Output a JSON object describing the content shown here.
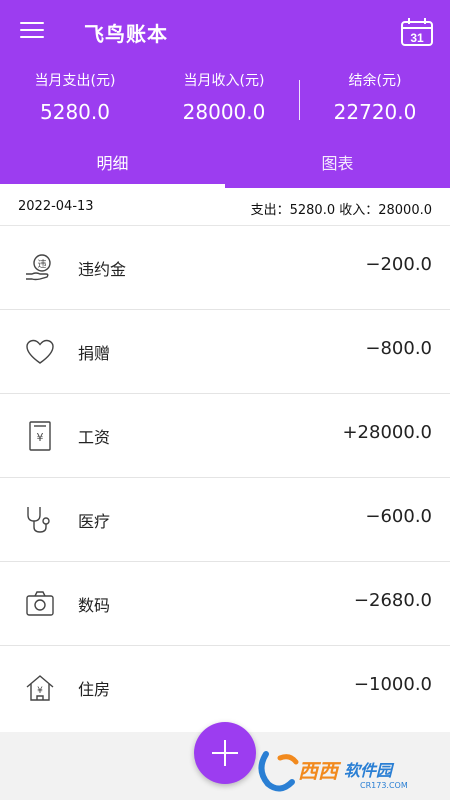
{
  "header": {
    "title": "飞鸟账本",
    "calendar_day": "31"
  },
  "summary": {
    "expense_label": "当月支出(元)",
    "expense_value": "5280.0",
    "income_label": "当月收入(元)",
    "income_value": "28000.0",
    "balance_label": "结余(元)",
    "balance_value": "22720.0"
  },
  "tabs": [
    {
      "label": "明细",
      "active": true
    },
    {
      "label": "图表",
      "active": false
    }
  ],
  "day": {
    "date": "2022-04-13",
    "summary": "支出：5280.0 收入：28000.0"
  },
  "entries": [
    {
      "icon": "penalty-icon",
      "category": "违约金",
      "amount": "−200.0"
    },
    {
      "icon": "heart-icon",
      "category": "捐赠",
      "amount": "−800.0"
    },
    {
      "icon": "salary-icon",
      "category": "工资",
      "amount": "+28000.0"
    },
    {
      "icon": "stethoscope-icon",
      "category": "医疗",
      "amount": "−600.0"
    },
    {
      "icon": "camera-icon",
      "category": "数码",
      "amount": "−2680.0"
    },
    {
      "icon": "house-icon",
      "category": "住房",
      "amount": "−1000.0"
    }
  ],
  "colors": {
    "accent": "#9c3df0",
    "watermark_blue": "#2a7fd4",
    "watermark_orange": "#f28a1e"
  },
  "watermark": {
    "text": "西西软件园",
    "sub": "CR173.COM"
  }
}
